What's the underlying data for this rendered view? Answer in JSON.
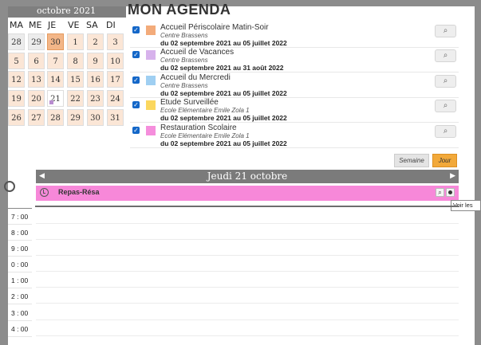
{
  "calendar": {
    "month_label": "octobre 2021",
    "day_headers": [
      "MA",
      "ME",
      "JE",
      "VE",
      "SA",
      "DI"
    ],
    "weeks": [
      [
        "28",
        "29",
        "30",
        "1",
        "2",
        "3"
      ],
      [
        "5",
        "6",
        "7",
        "8",
        "9",
        "10"
      ],
      [
        "12",
        "13",
        "14",
        "15",
        "16",
        "17"
      ],
      [
        "19",
        "20",
        "21",
        "22",
        "23",
        "24"
      ],
      [
        "26",
        "27",
        "28",
        "29",
        "30",
        "31"
      ]
    ]
  },
  "agenda": {
    "title": "MON AGENDA",
    "activities": [
      {
        "name": "Accueil Périscolaire Matin-Soir",
        "place": "Centre Brassens",
        "dates": "du 02 septembre 2021 au 05 juillet 2022",
        "color": "#f3ab7a"
      },
      {
        "name": "Accueil de Vacances",
        "place": "Centre Brassens",
        "dates": "du 02 septembre 2021 au 31 août 2022",
        "color": "#d7b2ec"
      },
      {
        "name": "Accueil du Mercredi",
        "place": "Centre Brassens",
        "dates": "du 02 septembre 2021 au 05 juillet 2022",
        "color": "#9fcff2"
      },
      {
        "name": "Etude Surveillée",
        "place": "Ecole Elémentaire Emile Zola 1",
        "dates": "du 02 septembre 2021 au 05 juillet 2022",
        "color": "#fbd75e"
      },
      {
        "name": "Restauration Scolaire",
        "place": "Ecole Elémentaire Emile Zola 1",
        "dates": "du 02 septembre 2021 au 05 juillet 2022",
        "color": "#f58edc"
      }
    ]
  },
  "view": {
    "week_label": "Semaine",
    "day_label": "Jour",
    "day_title": "Jeudi 21 octobre"
  },
  "event": {
    "label": "Repas-Résa",
    "color": "#f788d9",
    "tooltip": "Voir les"
  },
  "hours": [
    "7 : 00",
    "8 : 00",
    "9 : 00",
    "0 : 00",
    "1 : 00",
    "2 : 00",
    "3 : 00",
    "4 : 00"
  ]
}
